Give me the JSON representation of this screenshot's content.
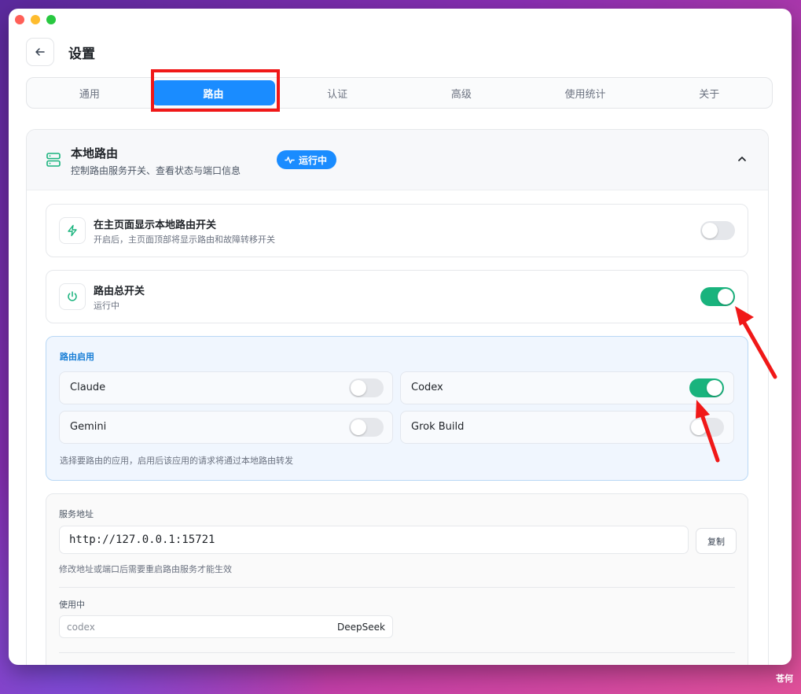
{
  "header": {
    "title": "设置"
  },
  "tabs": [
    {
      "label": "通用"
    },
    {
      "label": "路由"
    },
    {
      "label": "认证"
    },
    {
      "label": "高级"
    },
    {
      "label": "使用统计"
    },
    {
      "label": "关于"
    }
  ],
  "active_tab": "路由",
  "section": {
    "title": "本地路由",
    "subtitle": "控制路由服务开关、查看状态与端口信息",
    "status_badge": "运行中"
  },
  "rows": [
    {
      "title": "在主页面显示本地路由开关",
      "subtitle": "开启后，主页面顶部将显示路由和故障转移开关",
      "enabled": false
    },
    {
      "title": "路由总开关",
      "subtitle": "运行中",
      "enabled": true
    }
  ],
  "apps": {
    "title": "路由启用",
    "items": [
      {
        "name": "Claude",
        "enabled": false
      },
      {
        "name": "Codex",
        "enabled": true
      },
      {
        "name": "Gemini",
        "enabled": false
      },
      {
        "name": "Grok Build",
        "enabled": false
      }
    ],
    "hint": "选择要路由的应用，启用后该应用的请求将通过本地路由转发"
  },
  "service": {
    "address_label": "服务地址",
    "address_value": "http://127.0.0.1:15721",
    "copy_label": "复制",
    "hint": "修改地址或端口后需要重启路由服务才能生效",
    "in_use_label": "使用中",
    "in_use_key": "codex",
    "in_use_value": "DeepSeek"
  },
  "colors": {
    "accent": "#1a8cff",
    "toggle_on": "#19b37d",
    "highlight": "#f01818"
  },
  "watermark": "苍何"
}
